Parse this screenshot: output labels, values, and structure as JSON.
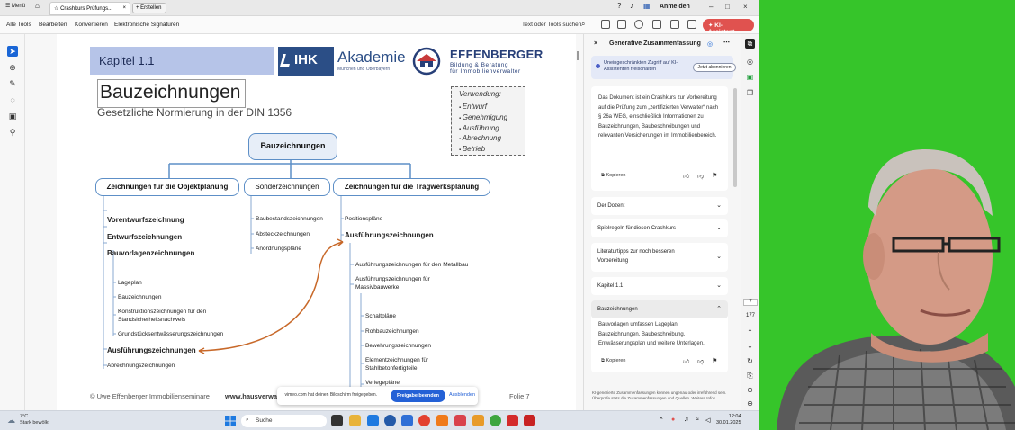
{
  "browser": {
    "menu_label": "Menü",
    "tab_title": "Crashkurs Prüfungs...",
    "new_tab_label": "Erstellen",
    "sign_in": "Anmelden"
  },
  "toolbar": {
    "items": [
      "Alle Tools",
      "Bearbeiten",
      "Konvertieren",
      "Elektronische Signaturen"
    ],
    "search_placeholder": "Text oder Tools suchen",
    "ki_button": "KI-Assistent"
  },
  "document": {
    "chapter": "Kapitel 1.1",
    "ihk_short": "IHK",
    "ihk_name": "Akademie",
    "ihk_sub": "München und Oberbayern",
    "eff_name": "EFFENBERGER",
    "eff_sub1": "Bildung & Beratung",
    "eff_sub2": "für Immobilienverwalter",
    "title": "Bauzeichnungen",
    "subtitle": "Gesetzliche Normierung in der DIN 1356",
    "usage_title": "Verwendung:",
    "usage_items": [
      "Entwurf",
      "Genehmigung",
      "Ausführung",
      "Abrechnung",
      "Betrieb"
    ],
    "root": "Bauzeichnungen",
    "branch_left": "Zeichnungen für die Objektplanung",
    "branch_mid": "Sonderzeichnungen",
    "branch_right": "Zeichnungen für die Tragwerksplanung",
    "left_bold": [
      "Vorentwurfszeichnung",
      "Entwurfszeichnungen",
      "Bauvorlagenzeichnungen"
    ],
    "left_sub": [
      "Lageplan",
      "Bauzeichnungen",
      "Konstruktionszeichnungen für den",
      "Standsicherheitsnachweis",
      "Grundstücksentwässerungszeichnungen"
    ],
    "left_bold2": "Ausführungszeichnungen",
    "left_last": "Abrechnungszeichnungen",
    "mid_items": [
      "Baubestandszeichnungen",
      "Absteckzeichnungen",
      "Anordnungspläne"
    ],
    "right_top": "Positionspläne",
    "right_bold": "Ausführungszeichnungen",
    "right_items": [
      "Ausführungszeichnungen für den Metallbau",
      "Ausführungszeichnungen für",
      "Massivbauwerke"
    ],
    "right_sub": [
      "Schaltpläne",
      "Rohbauzeichnungen",
      "Bewehrungszeichnungen",
      "Elementzeichnungen für",
      "Stahlbetonfertigteile",
      "Verlegepläne"
    ],
    "footer_left": "© Uwe Effenberger Immobilienseminare",
    "footer_mid": "www.hausverwal",
    "footer_right": "Folie 7"
  },
  "vimeo": {
    "text": "vimeo.com hat deinen Bildschirm freigegeben.",
    "share": "Freigabe beenden",
    "hide": "Ausblenden"
  },
  "panel": {
    "title": "Generative Zusammenfassung",
    "promo_text": "Uneingeschränkten Zugriff auf KI-Assistenten freischalten",
    "promo_button": "Jetzt abonnieren",
    "summary": "Das Dokument ist ein Crashkurs zur Vorbereitung auf die Prüfung zum „zertifizierten Verwalter“ nach § 26a WEG, einschließlich Informationen zu Bauzeichnungen, Baubeschreibungen und relevanten Versicherungen im Immobilienbereich.",
    "copy": "Kopieren",
    "sections": [
      "Der Dozent",
      "Spielregeln für diesen Crashkurs",
      "Literaturtipps zur noch besseren Vorbereitung",
      "Kapitel 1.1",
      "Bauzeichnungen"
    ],
    "section_text": "Bauvorlagen umfassen Lageplan, Bauzeichnungen, Baubeschreibung, Entwässerungsplan und weitere Unterlagen.",
    "disclaimer": "KI-generierte Zusammenfassungen können ungenau oder irreführend sein. Überprüfe stets die Zusammenfassungen und Quellen. Weitere Infos"
  },
  "pagenav": {
    "current": "7",
    "total": "177"
  },
  "taskbar": {
    "temp": "7°C",
    "weather": "Stark bewölkt",
    "search": "Suche",
    "time": "12:04",
    "date": "30.01.2025"
  },
  "colors": {
    "accent": "#1a66d6",
    "ki": "#e0524f",
    "node_border": "#5d8fc7",
    "arrow": "#c8692a",
    "green": "#36c52a"
  }
}
